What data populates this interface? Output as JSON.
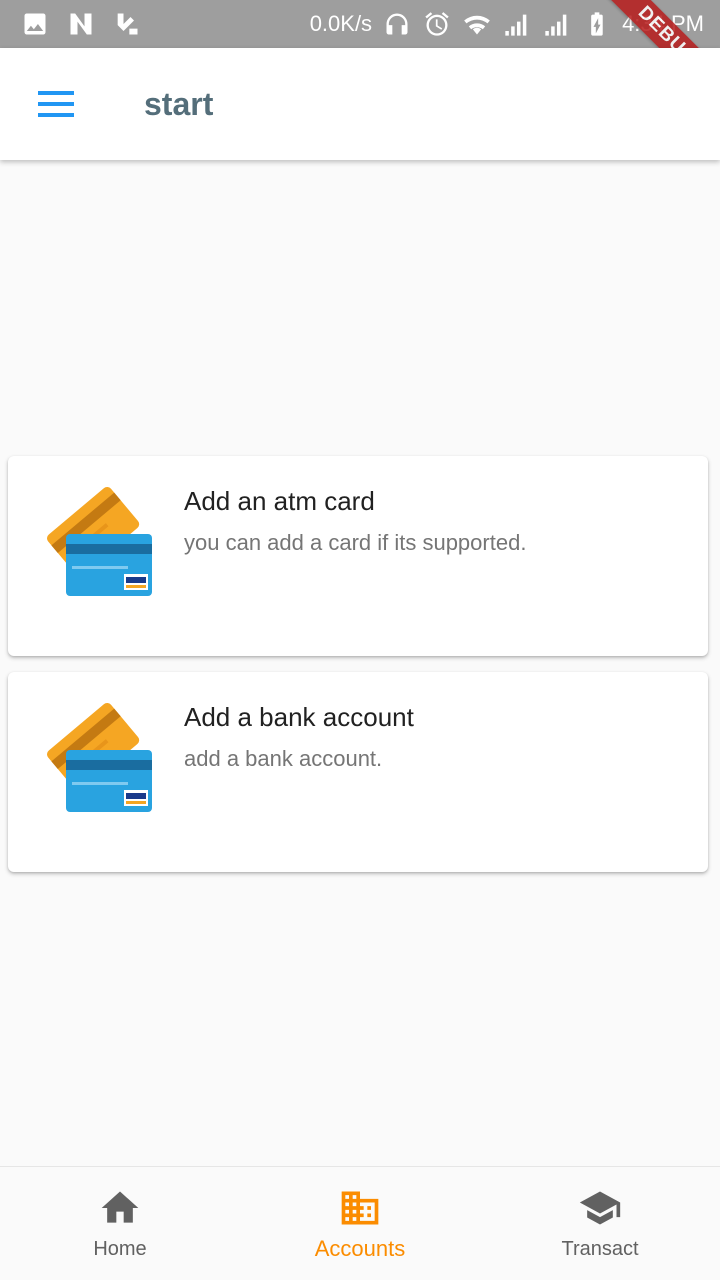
{
  "status_bar": {
    "net_speed": "0.0K/s",
    "time": "4:34 PM",
    "left_icons": [
      "image-icon",
      "n-logo-icon",
      "check-app-icon"
    ],
    "right_icons": [
      "headphones-icon",
      "alarm-icon",
      "wifi-icon",
      "signal-icon",
      "signal-icon",
      "battery-charging-icon"
    ]
  },
  "debug_banner": "DEBUG",
  "app_bar": {
    "title": "start",
    "menu_icon": "menu-icon",
    "accent_color": "#2196f3"
  },
  "cards": [
    {
      "title": "Add an atm card",
      "subtitle": "you can add a card if its supported.",
      "icon": "credit-cards-icon"
    },
    {
      "title": "Add a bank account",
      "subtitle": "add a bank account.",
      "icon": "credit-cards-icon"
    }
  ],
  "bottom_nav": {
    "items": [
      {
        "label": "Home",
        "icon": "home-icon",
        "active": false
      },
      {
        "label": "Accounts",
        "icon": "business-icon",
        "active": true
      },
      {
        "label": "Transact",
        "icon": "school-icon",
        "active": false
      }
    ],
    "active_color": "#fb8c00",
    "inactive_color": "#616161"
  }
}
